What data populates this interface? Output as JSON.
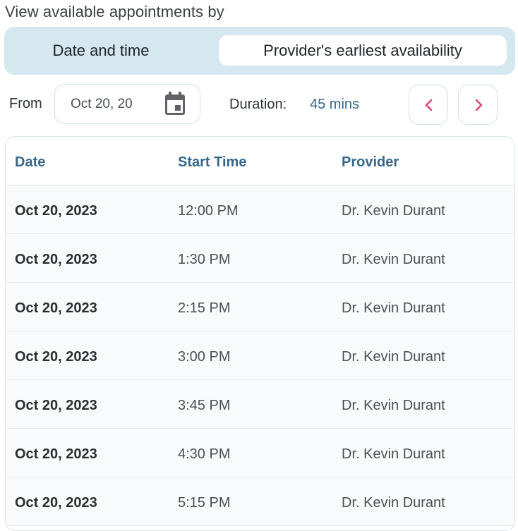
{
  "heading": "View available appointments by",
  "view_toggle": {
    "options": [
      "Date and time",
      "Provider's earliest availability"
    ],
    "selected": "Provider's earliest availability"
  },
  "filters": {
    "from_label": "From",
    "from_value": "Oct 20, 20",
    "duration_label": "Duration:",
    "duration_value": "45 mins"
  },
  "icons": {
    "calendar": "calendar-icon",
    "prev": "chevron-left-icon",
    "next": "chevron-right-icon"
  },
  "colors": {
    "accent_text": "#35678a",
    "nav_chevron": "#e0457b",
    "toggle_bg": "#d5e7ef"
  },
  "table": {
    "columns": [
      "Date",
      "Start Time",
      "Provider"
    ],
    "rows": [
      {
        "date": "Oct 20, 2023",
        "time": "12:00 PM",
        "provider": "Dr. Kevin Durant"
      },
      {
        "date": "Oct 20, 2023",
        "time": "1:30 PM",
        "provider": "Dr. Kevin Durant"
      },
      {
        "date": "Oct 20, 2023",
        "time": "2:15 PM",
        "provider": "Dr. Kevin Durant"
      },
      {
        "date": "Oct 20, 2023",
        "time": "3:00 PM",
        "provider": "Dr. Kevin Durant"
      },
      {
        "date": "Oct 20, 2023",
        "time": "3:45 PM",
        "provider": "Dr. Kevin Durant"
      },
      {
        "date": "Oct 20, 2023",
        "time": "4:30 PM",
        "provider": "Dr. Kevin Durant"
      },
      {
        "date": "Oct 20, 2023",
        "time": "5:15 PM",
        "provider": "Dr. Kevin Durant"
      }
    ]
  }
}
